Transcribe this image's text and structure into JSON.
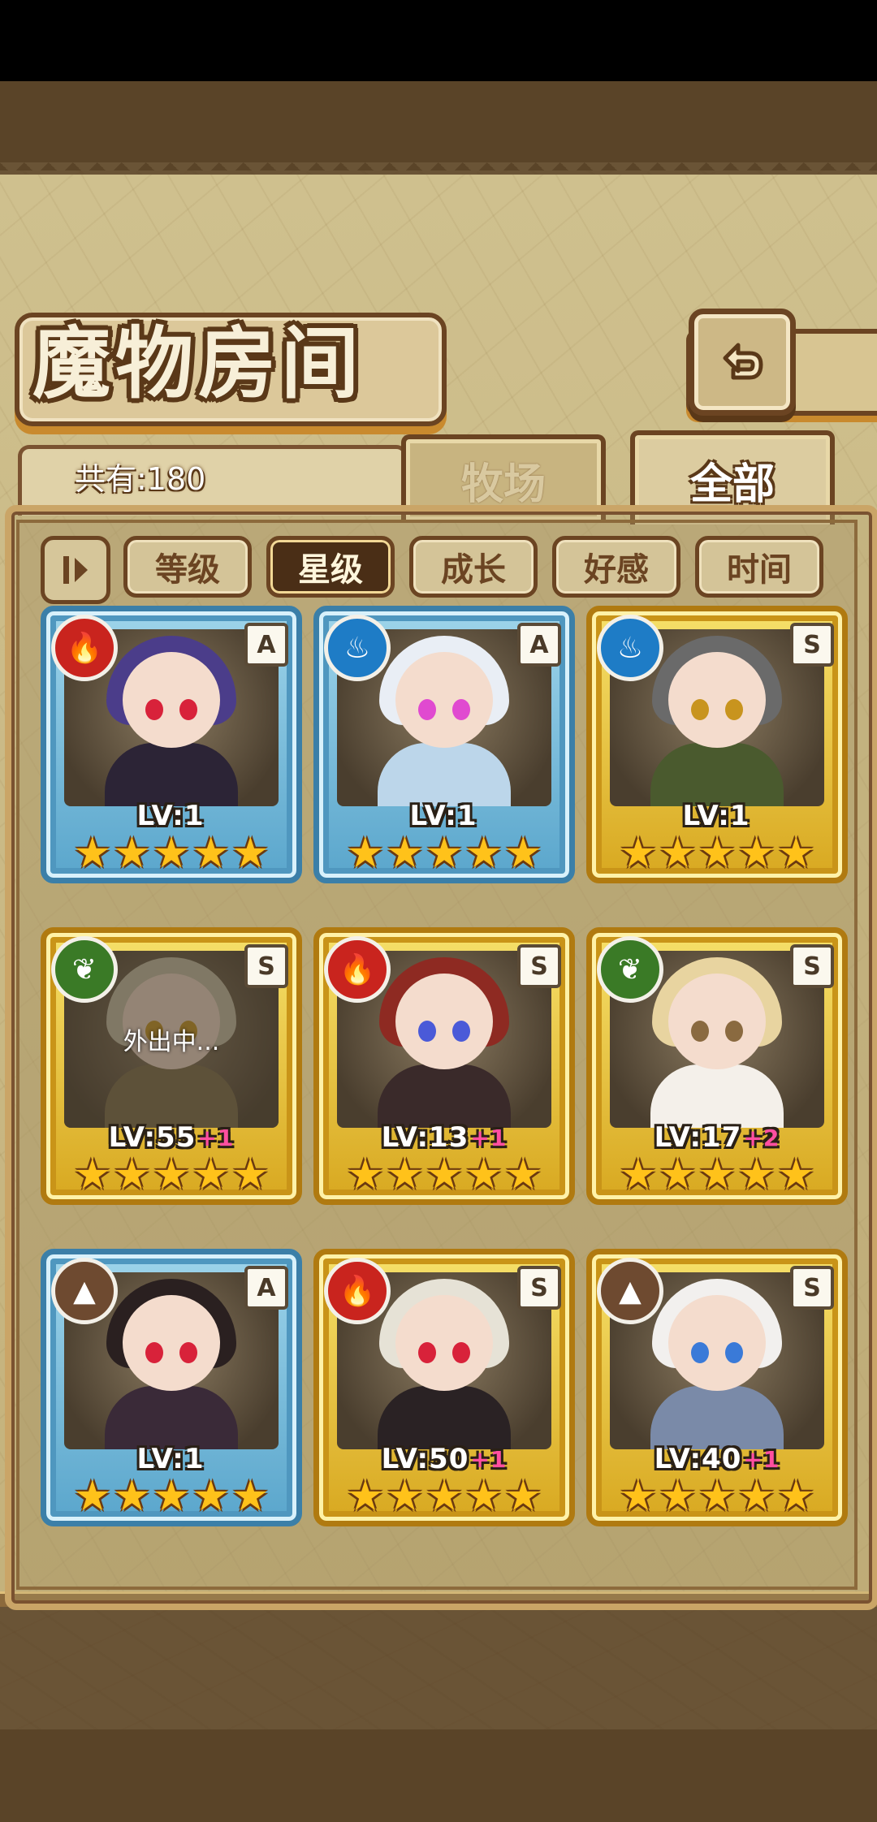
{
  "title": "魔物房间",
  "count_label": "共有:180",
  "tabs": [
    {
      "label": "牧场",
      "active": false
    },
    {
      "label": "全部",
      "active": true
    }
  ],
  "sort_buttons": [
    {
      "label": "等级",
      "active": false
    },
    {
      "label": "星级",
      "active": true
    },
    {
      "label": "成长",
      "active": false
    },
    {
      "label": "好感",
      "active": false
    },
    {
      "label": "时间",
      "active": false
    }
  ],
  "colors": {
    "accent_brown": "#6b4422",
    "parchment": "#cfc08e",
    "tier_A": "#5aa6cc",
    "tier_S": "#e0b026",
    "plus_pink": "#ff4fa0"
  },
  "monsters": [
    {
      "element": "fire-icon",
      "rank": "A",
      "lv_label": "LV:",
      "level": "1",
      "plus": "",
      "stars": 5,
      "status": ""
    },
    {
      "element": "water-icon",
      "rank": "A",
      "lv_label": "LV:",
      "level": "1",
      "plus": "",
      "stars": 5,
      "status": ""
    },
    {
      "element": "water-icon",
      "rank": "S",
      "lv_label": "LV:",
      "level": "1",
      "plus": "",
      "stars": 5,
      "status": ""
    },
    {
      "element": "leaf-icon",
      "rank": "S",
      "lv_label": "LV:",
      "level": "55",
      "plus": "+1",
      "stars": 5,
      "status": "外出中..."
    },
    {
      "element": "fire-icon",
      "rank": "S",
      "lv_label": "LV:",
      "level": "13",
      "plus": "+1",
      "stars": 5,
      "status": ""
    },
    {
      "element": "leaf-icon",
      "rank": "S",
      "lv_label": "LV:",
      "level": "17",
      "plus": "+2",
      "stars": 5,
      "status": ""
    },
    {
      "element": "earth-icon",
      "rank": "A",
      "lv_label": "LV:",
      "level": "1",
      "plus": "",
      "stars": 5,
      "status": ""
    },
    {
      "element": "fire-icon",
      "rank": "S",
      "lv_label": "LV:",
      "level": "50",
      "plus": "+1",
      "stars": 5,
      "status": ""
    },
    {
      "element": "earth-icon",
      "rank": "S",
      "lv_label": "LV:",
      "level": "40",
      "plus": "+1",
      "stars": 5,
      "status": ""
    }
  ]
}
